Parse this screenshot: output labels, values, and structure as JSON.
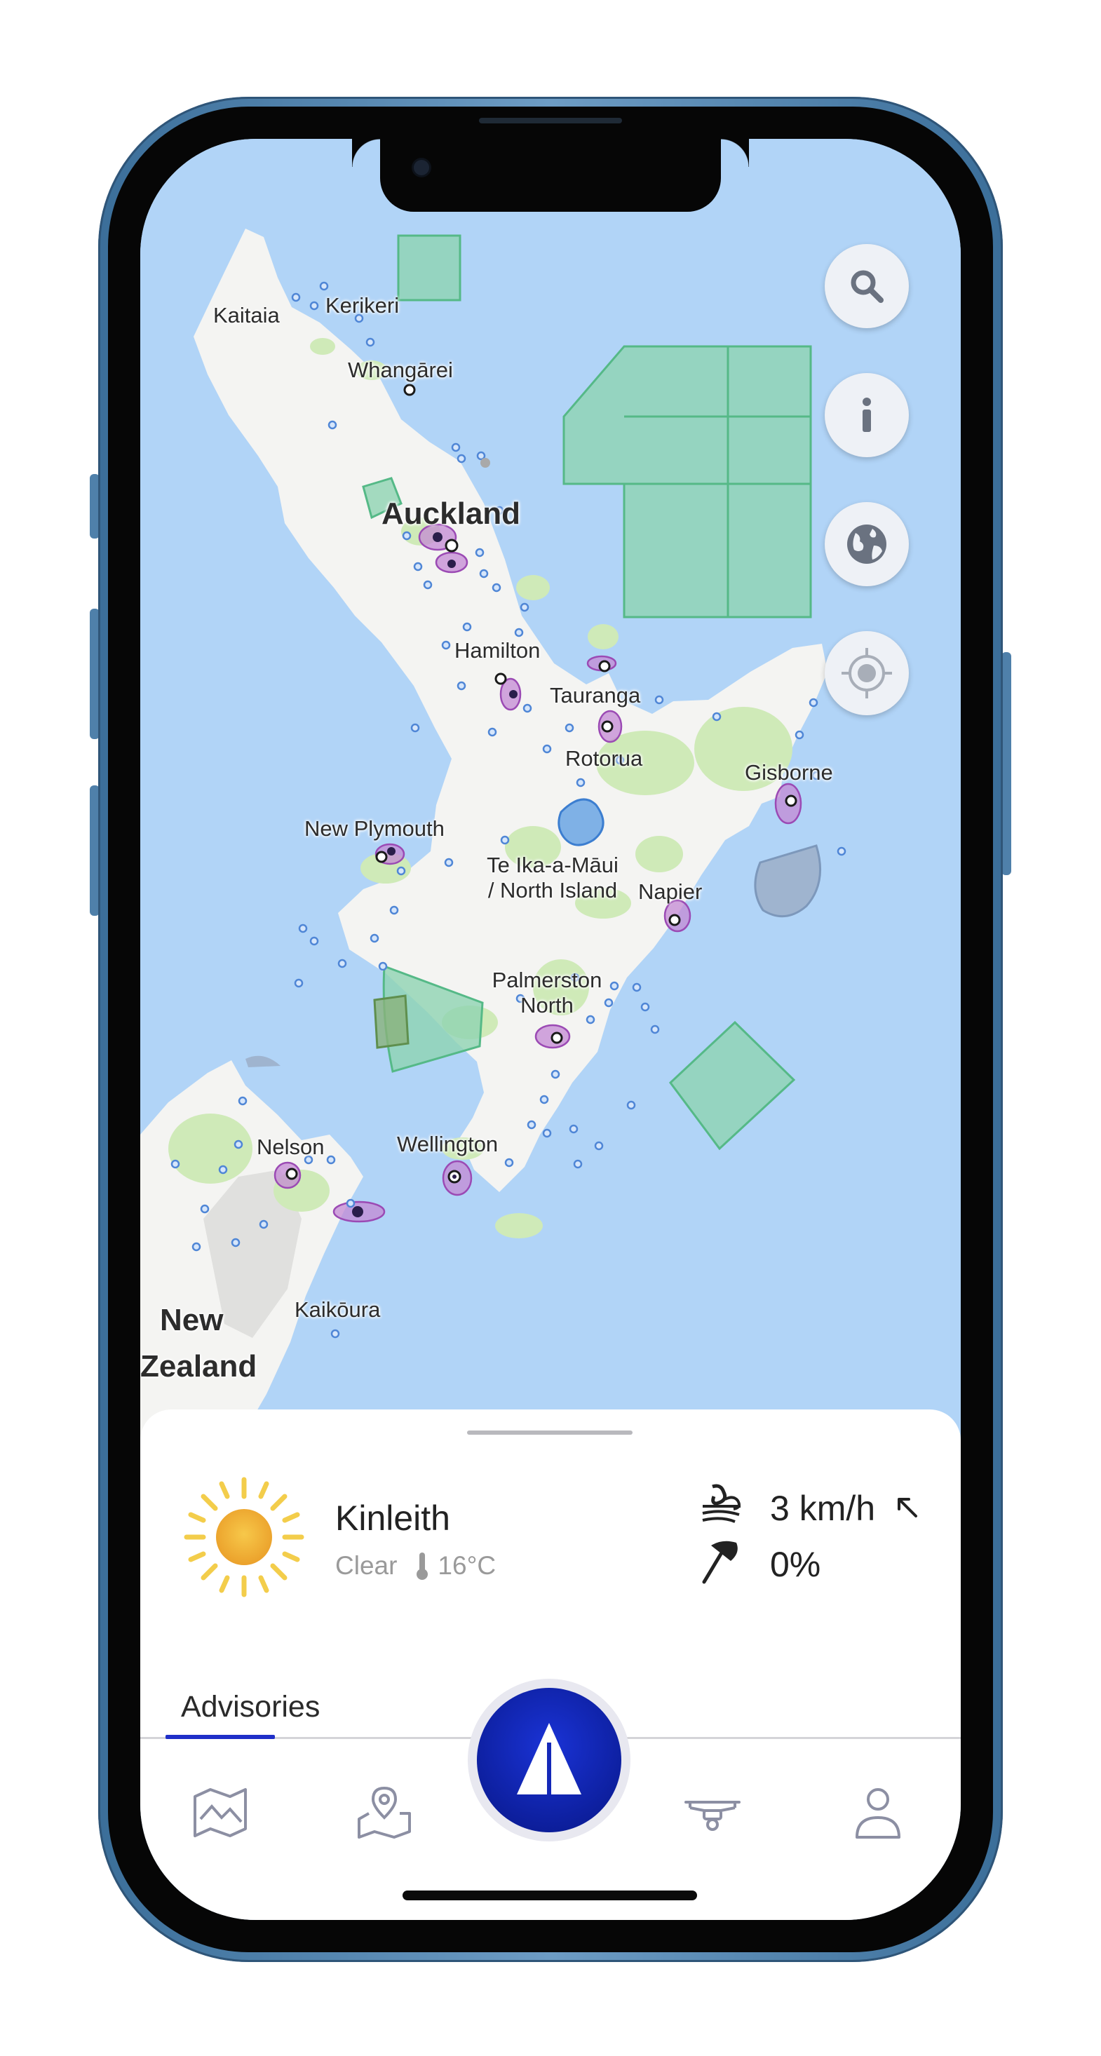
{
  "map": {
    "labels": {
      "kaitaia": "Kaitaia",
      "kerikeri": "Kerikeri",
      "whangarei": "Whangārei",
      "auckland": "Auckland",
      "hamilton": "Hamilton",
      "tauranga": "Tauranga",
      "rotorua": "Rotorua",
      "gisborne": "Gisborne",
      "new_plymouth": "New Plymouth",
      "north_island_1": "Te Ika-a-Māui",
      "north_island_2": "/ North Island",
      "napier": "Napier",
      "palmerston_1": "Palmerston",
      "palmerston_2": "North",
      "nelson": "Nelson",
      "wellington": "Wellington",
      "kaikoura": "Kaikōura",
      "new_zealand_1": "New",
      "new_zealand_2": "Zealand"
    },
    "controls": [
      "search-icon",
      "info-icon",
      "globe-icon",
      "locate-icon"
    ]
  },
  "weather": {
    "location": "Kinleith",
    "condition": "Clear",
    "temperature": "16°C",
    "wind_speed": "3 km/h",
    "rain_chance": "0%",
    "icon": "sun-icon"
  },
  "tabs": {
    "active": "Advisories"
  },
  "nav": {
    "items": [
      "map-book-icon",
      "map-pin-icon",
      "fly-icon",
      "drone-icon",
      "profile-icon"
    ]
  },
  "colors": {
    "water": "#b1d4f7",
    "land": "#f4f4f2",
    "park": "#cfeab8",
    "zone_green": "#8fd3b2",
    "accent": "#1f2fc8",
    "fly_button": "#0d1f9e"
  }
}
